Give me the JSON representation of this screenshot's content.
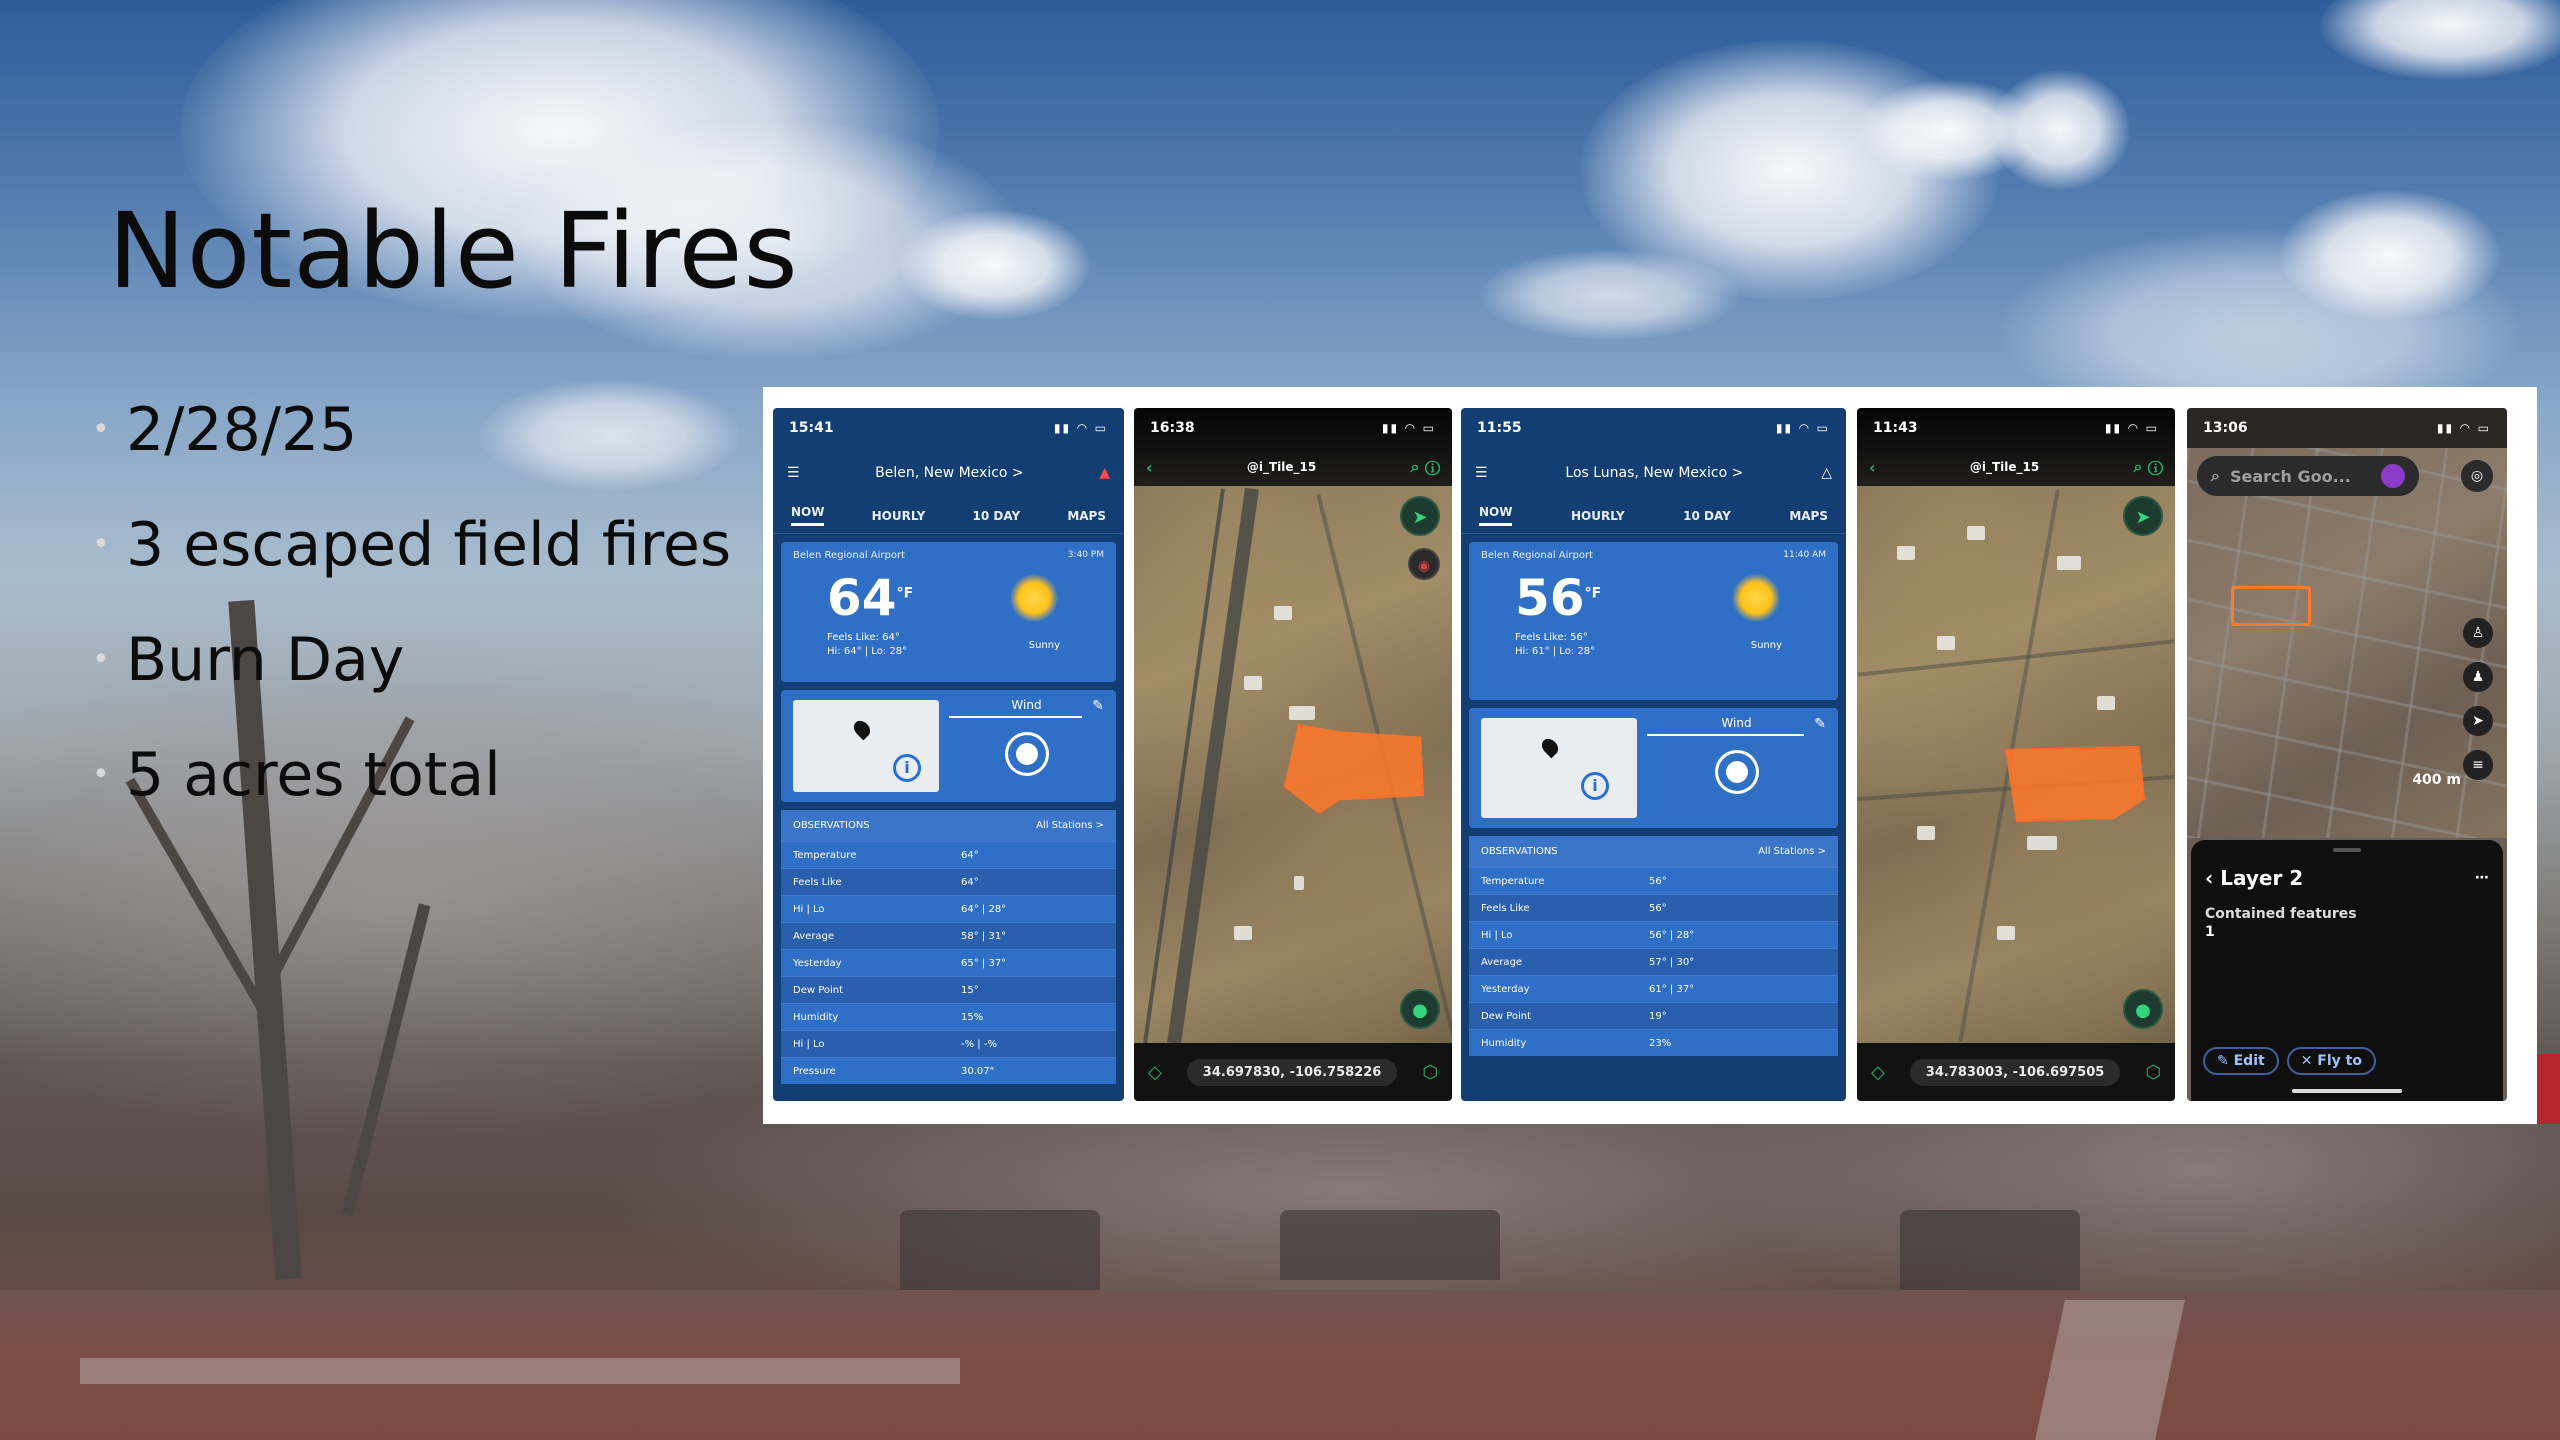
{
  "slide": {
    "title": "Notable Fires",
    "bullets": [
      "2/28/25",
      "3 escaped field fires",
      "Burn Day",
      "5 acres total"
    ]
  },
  "screenshots": {
    "weather1": {
      "status_time": "15:41",
      "location": "Belen, New Mexico >",
      "tabs": [
        "NOW",
        "HOURLY",
        "10 DAY",
        "MAPS"
      ],
      "station": "Belen Regional Airport",
      "time": "3:40 PM",
      "temp": "64",
      "temp_unit": "°F",
      "feels_like": "Feels Like: 64°",
      "hi_lo": "Hi: 64° | Lo: 28°",
      "condition": "Sunny",
      "wind_label": "Wind",
      "observations_label": "OBSERVATIONS",
      "all_stations": "All Stations >",
      "rows": [
        [
          "Temperature",
          "64°"
        ],
        [
          "Feels Like",
          "64°"
        ],
        [
          "Hi | Lo",
          "64° | 28°"
        ],
        [
          "Average",
          "58° | 31°"
        ],
        [
          "Yesterday",
          "65° | 37°"
        ],
        [
          "Dew Point",
          "15°"
        ],
        [
          "Humidity",
          "15%"
        ],
        [
          "Hi | Lo",
          "-% | -%"
        ],
        [
          "Pressure",
          "30.07\""
        ]
      ]
    },
    "map1": {
      "status_time": "16:38",
      "title": "@i_Tile_15",
      "coords": "34.697830, -106.758226"
    },
    "weather2": {
      "status_time": "11:55",
      "location": "Los Lunas, New Mexico >",
      "tabs": [
        "NOW",
        "HOURLY",
        "10 DAY",
        "MAPS"
      ],
      "station": "Belen Regional Airport",
      "time": "11:40 AM",
      "temp": "56",
      "temp_unit": "°F",
      "feels_like": "Feels Like: 56°",
      "hi_lo": "Hi: 61° | Lo: 28°",
      "condition": "Sunny",
      "wind_label": "Wind",
      "observations_label": "OBSERVATIONS",
      "all_stations": "All Stations >",
      "rows": [
        [
          "Temperature",
          "56°"
        ],
        [
          "Feels Like",
          "56°"
        ],
        [
          "Hi | Lo",
          "56° | 28°"
        ],
        [
          "Average",
          "57° | 30°"
        ],
        [
          "Yesterday",
          "61° | 37°"
        ],
        [
          "Dew Point",
          "19°"
        ],
        [
          "Humidity",
          "23%"
        ]
      ]
    },
    "map2": {
      "status_time": "11:43",
      "title": "@i_Tile_15",
      "coords": "34.783003, -106.697505"
    },
    "earth": {
      "status_time": "13:06",
      "search_placeholder": "Search Goo...",
      "scale": "400 m",
      "layer_title": "Layer 2",
      "contained_label": "Contained features",
      "contained_count": "1",
      "edit_label": "Edit",
      "fly_label": "Fly to"
    }
  },
  "colors": {
    "weather_blue": "#2f6fc6",
    "weather_navy": "#123e74",
    "burn_orange": "#ff6a2a",
    "accent_green": "#24b66a"
  }
}
